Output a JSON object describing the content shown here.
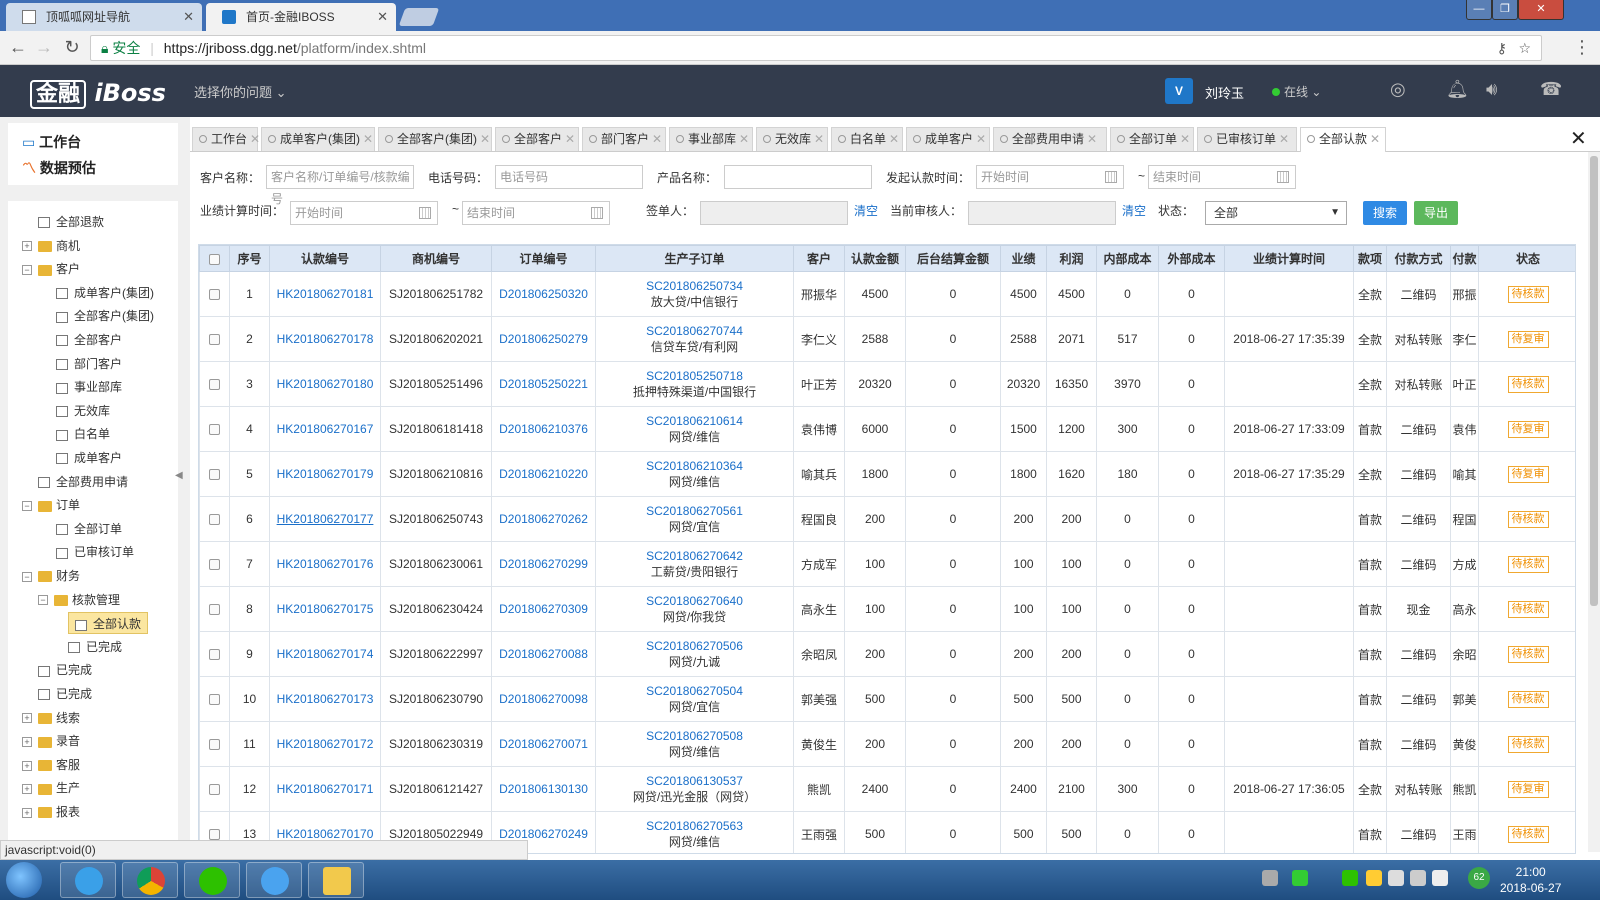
{
  "browser": {
    "tabs": [
      {
        "title": "顶呱呱网址导航"
      },
      {
        "title": "首页-金融IBOSS"
      }
    ],
    "secure_label": "安全",
    "url_scheme_host": "https://jriboss.dgg.net",
    "url_path": "/platform/index.shtml"
  },
  "header": {
    "logo_box": "金融",
    "logo_text": "iBoss",
    "issue_select": "选择你的问题",
    "user_name": "刘玲玉",
    "user_status": "在线"
  },
  "left": {
    "workbench": "工作台",
    "forecast": "数据预估",
    "tree": [
      {
        "label": "全部退款",
        "level": 1,
        "kind": "doc"
      },
      {
        "label": "商机",
        "level": 0,
        "kind": "folder",
        "exp": "+"
      },
      {
        "label": "客户",
        "level": 0,
        "kind": "folder",
        "exp": "-"
      },
      {
        "label": "成单客户(集团)",
        "level": 2,
        "kind": "doc"
      },
      {
        "label": "全部客户(集团)",
        "level": 2,
        "kind": "doc"
      },
      {
        "label": "全部客户",
        "level": 2,
        "kind": "doc"
      },
      {
        "label": "部门客户",
        "level": 2,
        "kind": "doc"
      },
      {
        "label": "事业部库",
        "level": 2,
        "kind": "doc"
      },
      {
        "label": "无效库",
        "level": 2,
        "kind": "doc"
      },
      {
        "label": "白名单",
        "level": 2,
        "kind": "doc"
      },
      {
        "label": "成单客户",
        "level": 2,
        "kind": "doc"
      },
      {
        "label": "全部费用申请",
        "level": 1,
        "kind": "doc"
      },
      {
        "label": "订单",
        "level": 0,
        "kind": "folder",
        "exp": "-"
      },
      {
        "label": "全部订单",
        "level": 2,
        "kind": "doc"
      },
      {
        "label": "已审核订单",
        "level": 2,
        "kind": "doc"
      },
      {
        "label": "财务",
        "level": 0,
        "kind": "folder",
        "exp": "-"
      },
      {
        "label": "核款管理",
        "level": 1,
        "kind": "folder",
        "exp": "-"
      },
      {
        "label": "全部认款",
        "level": 3,
        "kind": "doc",
        "selected": true
      },
      {
        "label": "已完成",
        "level": 3,
        "kind": "doc"
      },
      {
        "label": "已完成",
        "level": 1,
        "kind": "doc"
      },
      {
        "label": "已完成",
        "level": 1,
        "kind": "doc"
      },
      {
        "label": "线索",
        "level": 0,
        "kind": "folder",
        "exp": "+"
      },
      {
        "label": "录音",
        "level": 0,
        "kind": "folder",
        "exp": "+"
      },
      {
        "label": "客服",
        "level": 0,
        "kind": "folder",
        "exp": "+"
      },
      {
        "label": "生产",
        "level": 0,
        "kind": "folder",
        "exp": "+"
      },
      {
        "label": "报表",
        "level": 0,
        "kind": "folder",
        "exp": "+"
      }
    ]
  },
  "page_tabs": [
    "工作台",
    "成单客户(集团)",
    "全部客户(集团)",
    "全部客户",
    "部门客户",
    "事业部库",
    "无效库",
    "白名单",
    "成单客户",
    "全部费用申请",
    "全部订单",
    "已审核订单",
    "全部认款"
  ],
  "filters": {
    "customer_label": "客户名称：",
    "customer_ph": "客户名称/订单编号/核款编号",
    "phone_label": "电话号码：",
    "phone_ph": "电话号码",
    "product_label": "产品名称：",
    "start_label": "发起认款时间：",
    "start_ph": "开始时间",
    "end_ph": "结束时间",
    "perf_label": "业绩计算时间：",
    "perf_start_ph": "开始时间",
    "perf_end_ph": "结束时间",
    "tilde": "~",
    "signer_label": "签单人：",
    "clear": "清空",
    "reviewer_label": "当前审核人：",
    "status_label": "状态：",
    "status_value": "全部",
    "search": "搜索",
    "export": "导出"
  },
  "table": {
    "headers": [
      "序号",
      "认款编号",
      "商机编号",
      "订单编号",
      "生产子订单",
      "客户",
      "认款金额",
      "后台结算金额",
      "业绩",
      "利润",
      "内部成本",
      "外部成本",
      "业绩计算时间",
      "款项",
      "付款方式",
      "付款",
      "状态"
    ],
    "rows": [
      {
        "no": "1",
        "rk": "HK201806270181",
        "sj": "SJ201806251782",
        "dd": "D201806250320",
        "sc": "SC201806250734",
        "scsub": "放大贷/中信银行",
        "cust": "邢振华",
        "amt": "4500",
        "bg": "0",
        "yj": "4500",
        "lr": "4500",
        "nb": "0",
        "wb": "0",
        "time": "",
        "kx": "全款",
        "fk": "二维码",
        "fkr": "邢振",
        "st": "待核款"
      },
      {
        "no": "2",
        "rk": "HK201806270178",
        "sj": "SJ201806202021",
        "dd": "D201806250279",
        "sc": "SC201806270744",
        "scsub": "信贷车贷/有利网",
        "cust": "李仁义",
        "amt": "2588",
        "bg": "0",
        "yj": "2588",
        "lr": "2071",
        "nb": "517",
        "wb": "0",
        "time": "2018-06-27 17:35:39",
        "kx": "全款",
        "fk": "对私转账",
        "fkr": "李仁",
        "st": "待复审"
      },
      {
        "no": "3",
        "rk": "HK201806270180",
        "sj": "SJ201805251496",
        "dd": "D201805250221",
        "sc": "SC201805250718",
        "scsub": "抵押特殊渠道/中国银行",
        "cust": "叶正芳",
        "amt": "20320",
        "bg": "0",
        "yj": "20320",
        "lr": "16350",
        "nb": "3970",
        "wb": "0",
        "time": "",
        "kx": "全款",
        "fk": "对私转账",
        "fkr": "叶正",
        "st": "待核款"
      },
      {
        "no": "4",
        "rk": "HK201806270167",
        "sj": "SJ201806181418",
        "dd": "D201806210376",
        "sc": "SC201806210614",
        "scsub": "网贷/维信",
        "cust": "袁伟博",
        "amt": "6000",
        "bg": "0",
        "yj": "1500",
        "lr": "1200",
        "nb": "300",
        "wb": "0",
        "time": "2018-06-27 17:33:09",
        "kx": "首款",
        "fk": "二维码",
        "fkr": "袁伟",
        "st": "待复审"
      },
      {
        "no": "5",
        "rk": "HK201806270179",
        "sj": "SJ201806210816",
        "dd": "D201806210220",
        "sc": "SC201806210364",
        "scsub": "网贷/维信",
        "cust": "喻其兵",
        "amt": "1800",
        "bg": "0",
        "yj": "1800",
        "lr": "1620",
        "nb": "180",
        "wb": "0",
        "time": "2018-06-27 17:35:29",
        "kx": "全款",
        "fk": "二维码",
        "fkr": "喻其",
        "st": "待复审"
      },
      {
        "no": "6",
        "rk": "HK201806270177",
        "sj": "SJ201806250743",
        "dd": "D201806270262",
        "sc": "SC201806270561",
        "scsub": "网贷/宜信",
        "cust": "程国良",
        "amt": "200",
        "bg": "0",
        "yj": "200",
        "lr": "200",
        "nb": "0",
        "wb": "0",
        "time": "",
        "kx": "首款",
        "fk": "二维码",
        "fkr": "程国",
        "st": "待核款"
      },
      {
        "no": "7",
        "rk": "HK201806270176",
        "sj": "SJ201806230061",
        "dd": "D201806270299",
        "sc": "SC201806270642",
        "scsub": "工薪贷/贵阳银行",
        "cust": "方成军",
        "amt": "100",
        "bg": "0",
        "yj": "100",
        "lr": "100",
        "nb": "0",
        "wb": "0",
        "time": "",
        "kx": "首款",
        "fk": "二维码",
        "fkr": "方成",
        "st": "待核款"
      },
      {
        "no": "8",
        "rk": "HK201806270175",
        "sj": "SJ201806230424",
        "dd": "D201806270309",
        "sc": "SC201806270640",
        "scsub": "网贷/你我贷",
        "cust": "高永生",
        "amt": "100",
        "bg": "0",
        "yj": "100",
        "lr": "100",
        "nb": "0",
        "wb": "0",
        "time": "",
        "kx": "首款",
        "fk": "现金",
        "fkr": "高永",
        "st": "待核款"
      },
      {
        "no": "9",
        "rk": "HK201806270174",
        "sj": "SJ201806222997",
        "dd": "D201806270088",
        "sc": "SC201806270506",
        "scsub": "网贷/九诚",
        "cust": "余昭凤",
        "amt": "200",
        "bg": "0",
        "yj": "200",
        "lr": "200",
        "nb": "0",
        "wb": "0",
        "time": "",
        "kx": "首款",
        "fk": "二维码",
        "fkr": "余昭",
        "st": "待核款"
      },
      {
        "no": "10",
        "rk": "HK201806270173",
        "sj": "SJ201806230790",
        "dd": "D201806270098",
        "sc": "SC201806270504",
        "scsub": "网贷/宜信",
        "cust": "郭美强",
        "amt": "500",
        "bg": "0",
        "yj": "500",
        "lr": "500",
        "nb": "0",
        "wb": "0",
        "time": "",
        "kx": "首款",
        "fk": "二维码",
        "fkr": "郭美",
        "st": "待核款"
      },
      {
        "no": "11",
        "rk": "HK201806270172",
        "sj": "SJ201806230319",
        "dd": "D201806270071",
        "sc": "SC201806270508",
        "scsub": "网贷/维信",
        "cust": "黄俊生",
        "amt": "200",
        "bg": "0",
        "yj": "200",
        "lr": "200",
        "nb": "0",
        "wb": "0",
        "time": "",
        "kx": "首款",
        "fk": "二维码",
        "fkr": "黄俊",
        "st": "待核款"
      },
      {
        "no": "12",
        "rk": "HK201806270171",
        "sj": "SJ201806121427",
        "dd": "D201806130130",
        "sc": "SC201806130537",
        "scsub": "网贷/迅光金服（网贷）",
        "cust": "熊凯",
        "amt": "2400",
        "bg": "0",
        "yj": "2400",
        "lr": "2100",
        "nb": "300",
        "wb": "0",
        "time": "2018-06-27 17:36:05",
        "kx": "全款",
        "fk": "对私转账",
        "fkr": "熊凯",
        "st": "待复审"
      },
      {
        "no": "13",
        "rk": "HK201806270170",
        "sj": "SJ201805022949",
        "dd": "D201806270249",
        "sc": "SC201806270563",
        "scsub": "网贷/维信",
        "cust": "王雨强",
        "amt": "500",
        "bg": "0",
        "yj": "500",
        "lr": "500",
        "nb": "0",
        "wb": "0",
        "time": "",
        "kx": "首款",
        "fk": "二维码",
        "fkr": "王雨",
        "st": "待核款"
      }
    ]
  },
  "statusbar": "javascript:void(0)",
  "clock": {
    "time": "21:00",
    "date": "2018-06-27"
  },
  "tray_badge": "62",
  "colors": {
    "link": "#1a6fc9",
    "header_bg": "#333c4d",
    "badge_orange": "#f09000",
    "search_btn": "#2f8ae4",
    "export_btn": "#5cb85c"
  }
}
